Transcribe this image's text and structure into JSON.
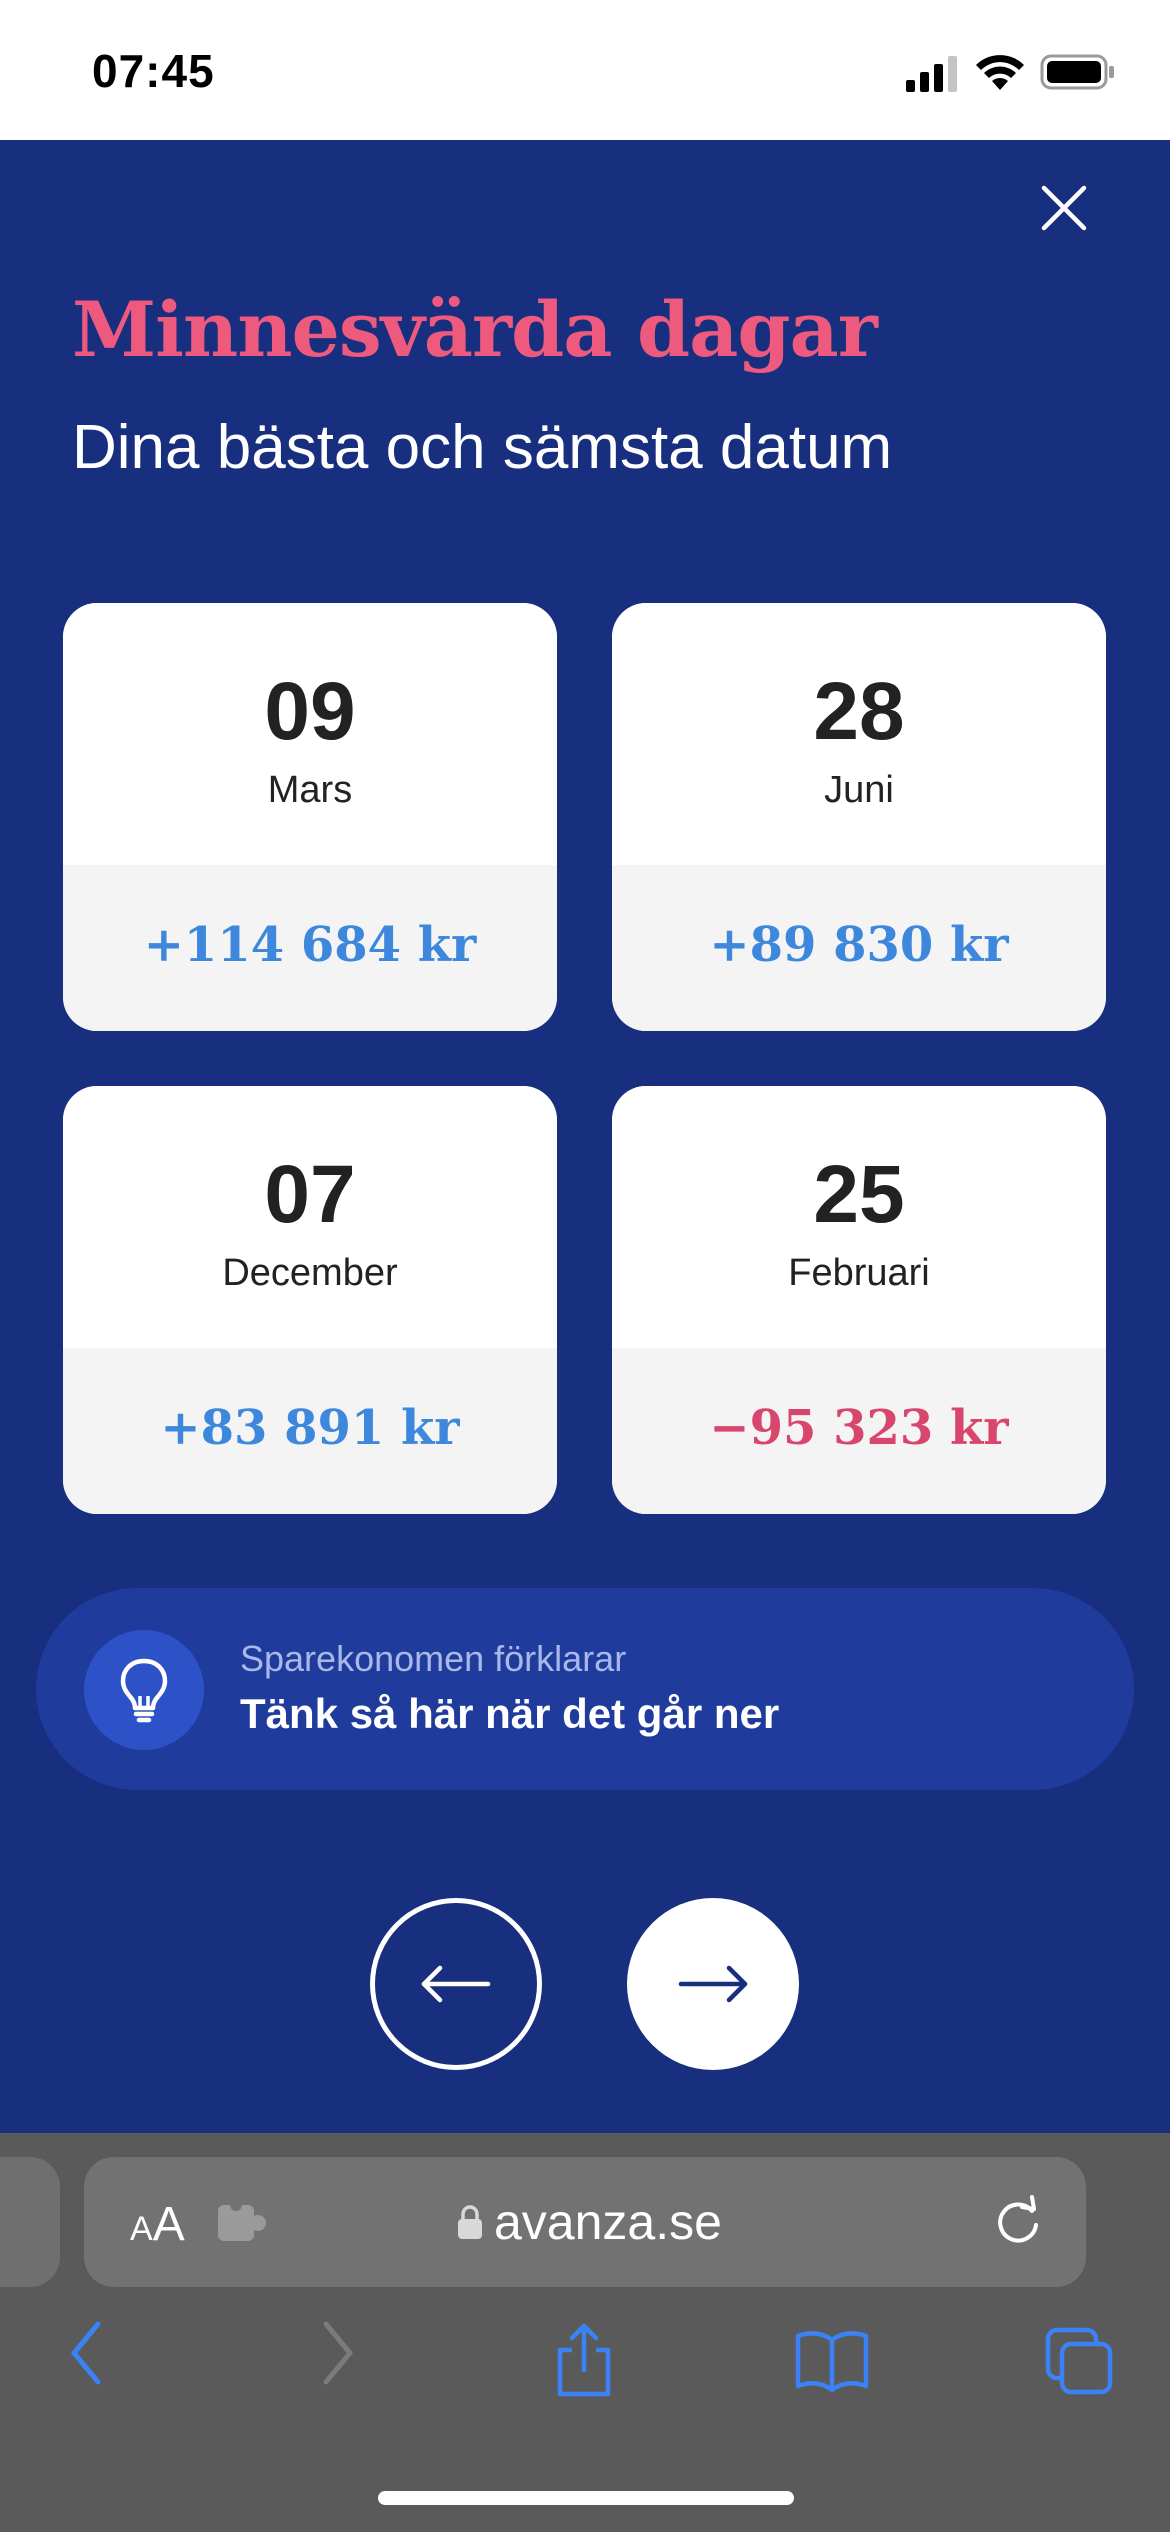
{
  "status_bar": {
    "time": "07:45"
  },
  "modal": {
    "title": "Minnesvärda dagar",
    "subtitle": "Dina bästa och sämsta datum",
    "close_icon": "close-icon"
  },
  "cards": [
    {
      "day": "09",
      "month": "Mars",
      "amount": "+114 684 kr",
      "sentiment": "positive"
    },
    {
      "day": "28",
      "month": "Juni",
      "amount": "+89 830 kr",
      "sentiment": "positive"
    },
    {
      "day": "07",
      "month": "December",
      "amount": "+83 891 kr",
      "sentiment": "positive"
    },
    {
      "day": "25",
      "month": "Februari",
      "amount": "−95 323 kr",
      "sentiment": "negative"
    }
  ],
  "tip": {
    "overline": "Sparekonomen förklarar",
    "headline": "Tänk så här när det går ner",
    "icon": "lightbulb-icon"
  },
  "navigation": {
    "prev_icon": "arrow-left-icon",
    "next_icon": "arrow-right-icon"
  },
  "browser": {
    "text_size_small": "A",
    "text_size_big": "A",
    "domain": "avanza.se",
    "icons": [
      "extension-icon",
      "lock-icon",
      "reload-icon",
      "back-icon",
      "forward-icon",
      "share-icon",
      "bookmarks-icon",
      "tabs-icon"
    ]
  },
  "colors": {
    "background": "#182e7e",
    "title": "#ee5a7e",
    "positive": "#3d87dc",
    "negative": "#d9466d",
    "tip_background": "#1f3b9c",
    "browser_chrome": "#5a5a5a",
    "toolbar_active": "#3b82f6"
  }
}
